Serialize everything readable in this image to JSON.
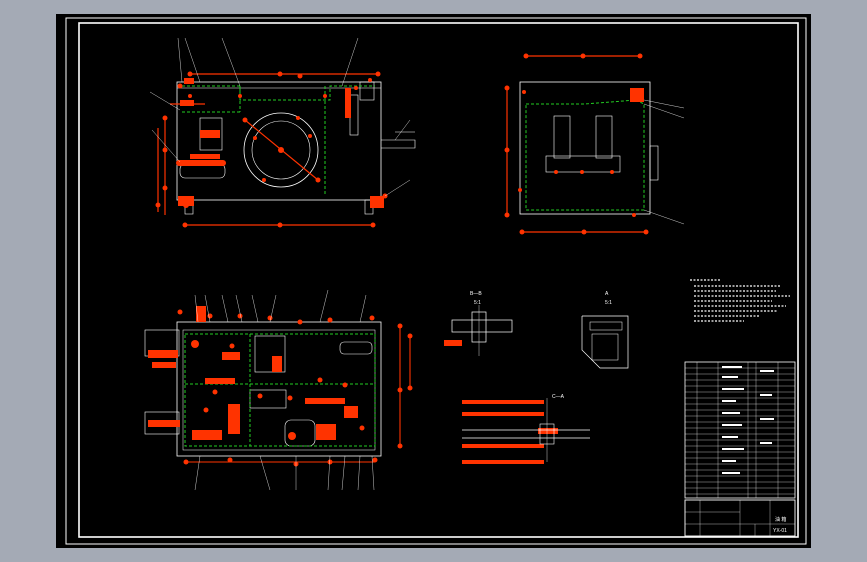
{
  "colors": {
    "background": "#a4aab5",
    "sheet": "#000000",
    "outline": "#ffffff",
    "dimension": "#ff3300",
    "hidden_line": "#22cc22",
    "annotation": "#ffffff"
  },
  "sections": {
    "section_b": {
      "label": "B—B",
      "scale": "5:1"
    },
    "section_a": {
      "label": "A",
      "scale": "5:1"
    },
    "section_c": {
      "label": "C—A"
    }
  },
  "title_block": {
    "title": "油 箱",
    "drawing_no": "YX-01"
  }
}
